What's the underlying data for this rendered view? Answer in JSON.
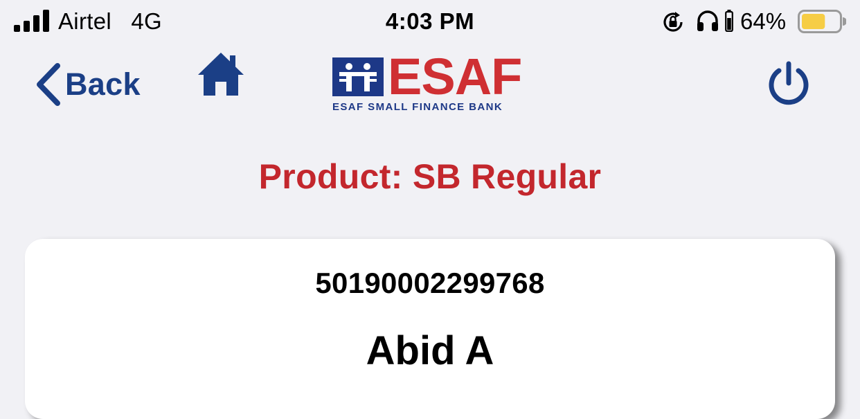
{
  "status_bar": {
    "carrier": "Airtel",
    "network": "4G",
    "time": "4:03 PM",
    "battery_percent": "64%",
    "battery_level": 0.64,
    "icons": [
      "signal-bars-icon",
      "rotation-lock-icon",
      "headphones-icon",
      "battery-icon"
    ]
  },
  "nav": {
    "back_label": "Back",
    "icons": [
      "chevron-left-icon",
      "home-icon",
      "power-icon"
    ]
  },
  "logo": {
    "name": "ESAF",
    "tagline": "ESAF SMALL FINANCE BANK"
  },
  "product": {
    "label": "Product:",
    "name": "SB Regular"
  },
  "account": {
    "number": "50190002299768",
    "holder_name": "Abid A"
  },
  "colors": {
    "background": "#f1f1f5",
    "brand_blue": "#1b3f86",
    "brand_red": "#c3272d",
    "battery_fill": "#f6cd45"
  }
}
